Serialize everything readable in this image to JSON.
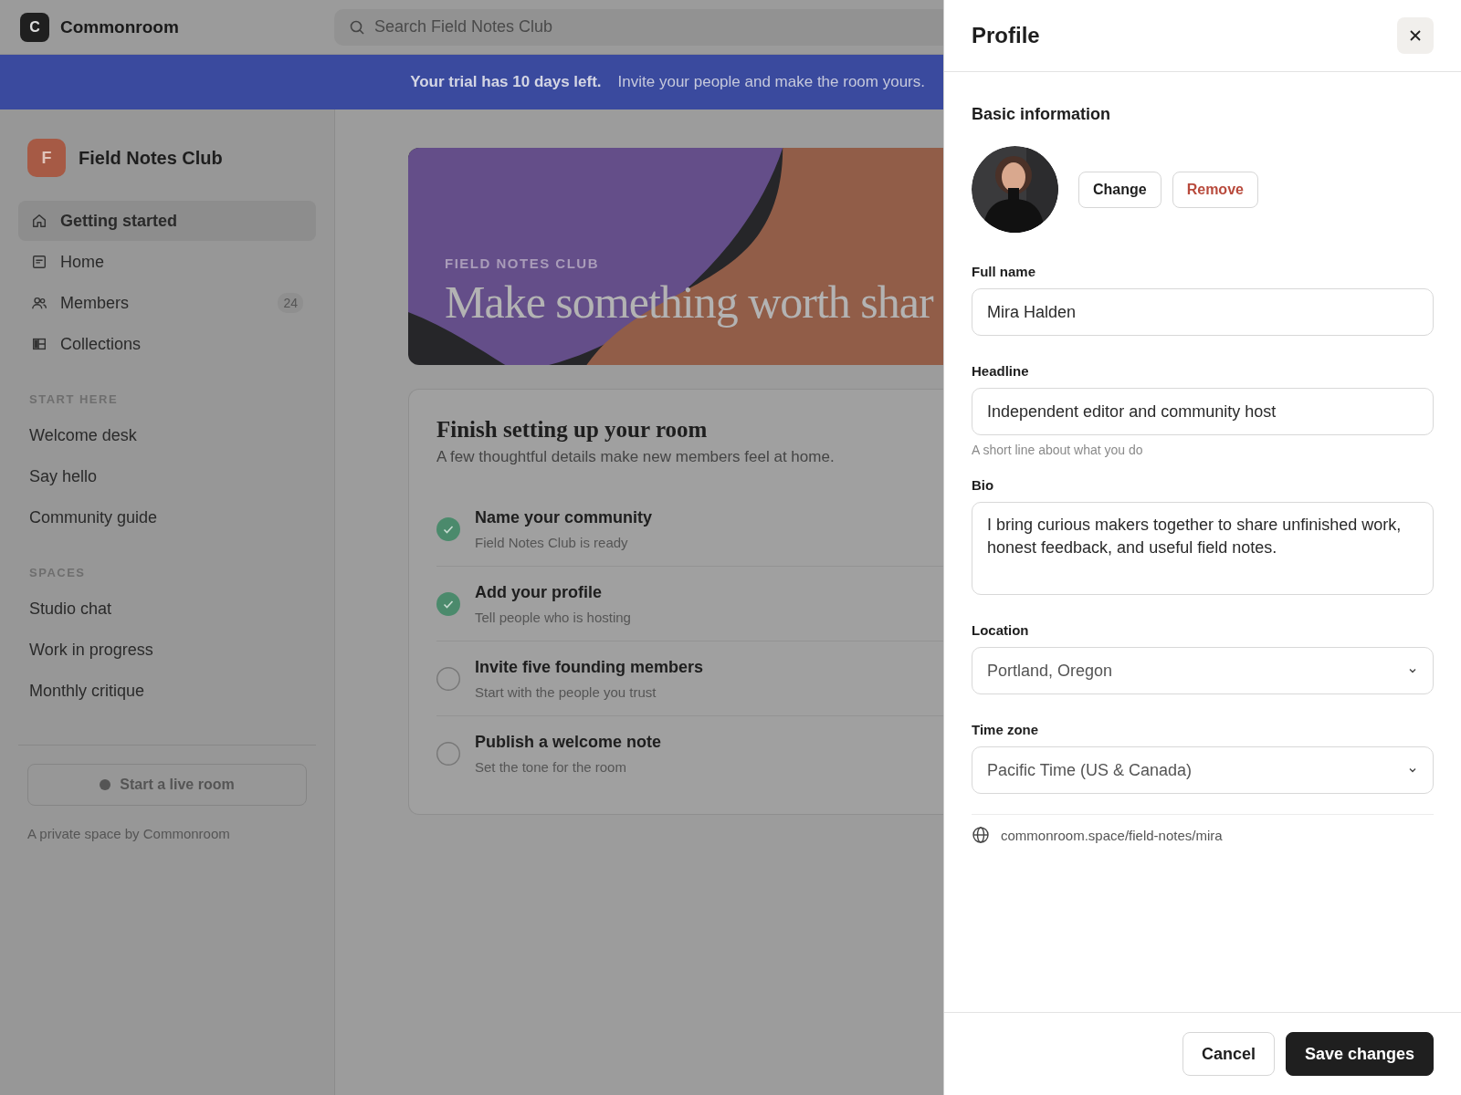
{
  "app": {
    "logo_letter": "C",
    "name": "Commonroom"
  },
  "search": {
    "placeholder": "Search Field Notes Club"
  },
  "banner": {
    "bold": "Your trial has 10 days left.",
    "text": "Invite your people and make the room yours."
  },
  "sidebar": {
    "community": {
      "initial": "F",
      "name": "Field Notes Club"
    },
    "nav": [
      {
        "label": "Getting started",
        "selected": true
      },
      {
        "label": "Home",
        "selected": false
      },
      {
        "label": "Members",
        "selected": false,
        "badge": "24"
      },
      {
        "label": "Collections",
        "selected": false
      }
    ],
    "sections": [
      {
        "title": "START HERE",
        "items": [
          {
            "label": "Welcome desk",
            "selected": false
          },
          {
            "label": "Say hello",
            "selected": false
          },
          {
            "label": "Community guide",
            "selected": false
          }
        ]
      },
      {
        "title": "SPACES",
        "items": [
          {
            "label": "Studio chat",
            "selected": false
          },
          {
            "label": "Work in progress",
            "selected": false
          },
          {
            "label": "Monthly critique",
            "selected": false
          }
        ]
      }
    ],
    "live_button": "Start a live room",
    "footer": "A private space by Commonroom"
  },
  "hero": {
    "eyebrow": "FIELD NOTES CLUB",
    "title": "Make something worth shar"
  },
  "setup": {
    "title": "Finish setting up your room",
    "subtitle": "A few thoughtful details make new members feel at home.",
    "steps": [
      {
        "title": "Name your community",
        "subtitle": "Field Notes Club is ready",
        "checked": true
      },
      {
        "title": "Add your profile",
        "subtitle": "Tell people who is hosting",
        "checked": true
      },
      {
        "title": "Invite five founding members",
        "subtitle": "Start with the people you trust",
        "checked": false
      },
      {
        "title": "Publish a welcome note",
        "subtitle": "Set the tone for the room",
        "checked": false
      }
    ]
  },
  "profile_panel": {
    "title": "Profile",
    "section": "Basic information",
    "photo_buttons": [
      {
        "label": "Change",
        "kind": "default"
      },
      {
        "label": "Remove",
        "kind": "danger"
      }
    ],
    "fields": [
      {
        "kind": "text",
        "label": "Full name",
        "value": "Mira Halden"
      },
      {
        "kind": "text",
        "label": "Headline",
        "value": "Independent editor and community host",
        "hint": "A short line about what you do"
      },
      {
        "kind": "textarea",
        "label": "Bio",
        "value": "I bring curious makers together to share unfinished work, honest feedback, and useful field notes."
      },
      {
        "kind": "select",
        "label": "Location",
        "value": "Portland, Oregon"
      },
      {
        "kind": "select",
        "label": "Time zone",
        "value": "Pacific Time (US & Canada)"
      }
    ],
    "url": "commonroom.space/field-notes/mira",
    "buttons": [
      {
        "label": "Cancel",
        "kind": "secondary"
      },
      {
        "label": "Save changes",
        "kind": "primary"
      }
    ]
  }
}
